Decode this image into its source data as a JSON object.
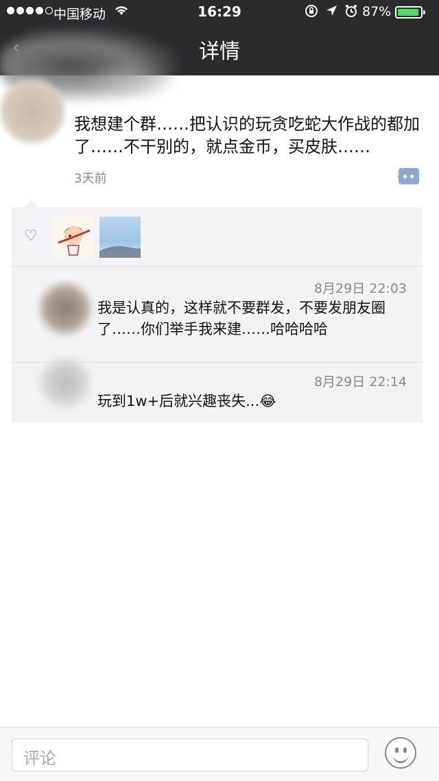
{
  "status_bar": {
    "carrier": "中国移动",
    "time": "16:29",
    "battery_percent": "87%",
    "signal_bars": 4,
    "icons": [
      "wifi-icon",
      "lock-rotation-icon",
      "location-icon",
      "alarm-icon",
      "battery-icon"
    ]
  },
  "nav": {
    "title": "详情"
  },
  "post": {
    "text": "我想建个群……把认识的玩贪吃蛇大作战的都加了……不干别的，就点金币，买皮肤……",
    "time": "3天前"
  },
  "likes": {
    "count": 2
  },
  "comments": [
    {
      "time": "8月29日 22:03",
      "text": "我是认真的，这样就不要群发，不要发朋友圈了……你们举手我来建……哈哈哈哈"
    },
    {
      "time": "8月29日 22:14",
      "text": "玩到1w+后就兴趣丧失...😂"
    }
  ],
  "input": {
    "placeholder": "评论"
  }
}
